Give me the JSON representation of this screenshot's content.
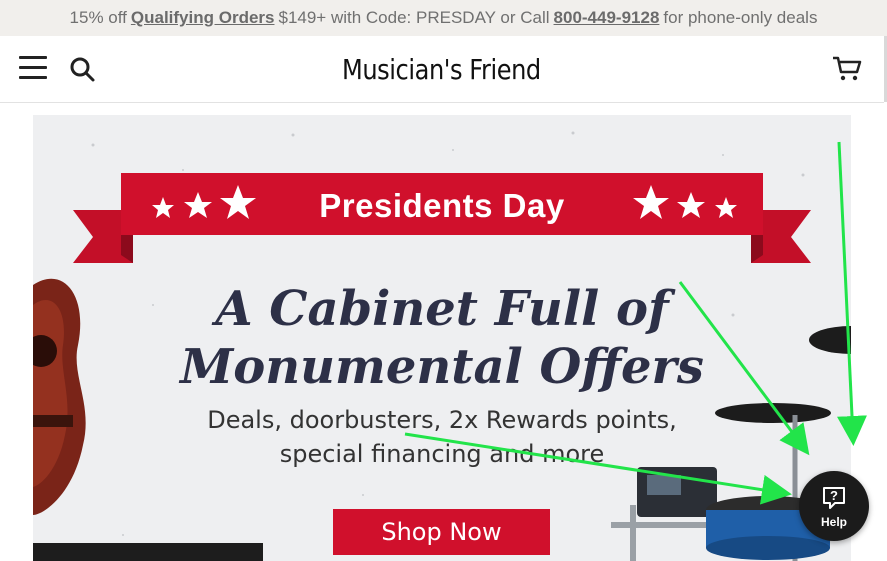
{
  "promo": {
    "prefix": "15% off",
    "link": "Qualifying Orders",
    "middle": "$149+ with Code: PRESDAY or Call",
    "phone": "800-449-9128",
    "suffix": "for phone-only deals"
  },
  "header": {
    "logo_text": "Musician's Friend",
    "icons": [
      "menu-icon",
      "search-icon",
      "cart-icon"
    ]
  },
  "hero": {
    "banner_title": "Presidents Day",
    "headline_line1": "A Cabinet Full of",
    "headline_line2": "Monumental Offers",
    "sub_line1": "Deals, doorbusters, 2x Rewards points,",
    "sub_line2": "special financing and more",
    "cta": "Shop Now"
  },
  "help": {
    "label": "Help",
    "icon": "question-icon"
  },
  "colors": {
    "brand_red": "#d0102c",
    "logo_gold": "#e8b422",
    "headline_navy": "#2d3047",
    "annotation_green": "#22e44a"
  }
}
